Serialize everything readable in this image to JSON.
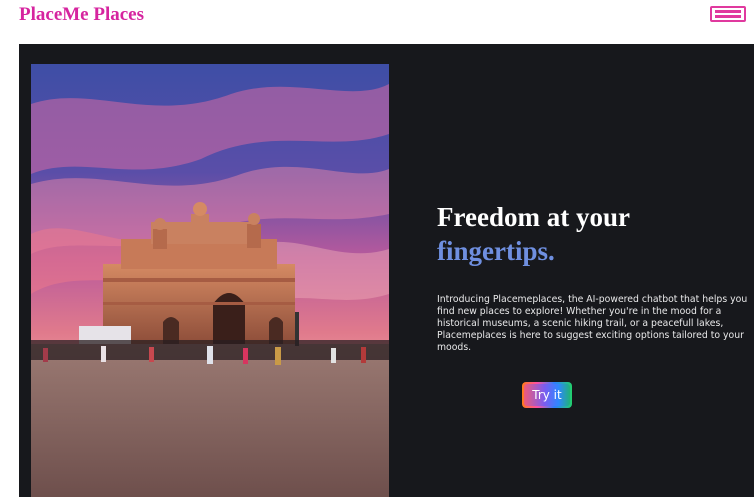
{
  "navbar": {
    "brand": "PlaceMe Places",
    "menu_icon": "hamburger-menu-icon"
  },
  "hero": {
    "image_subject": "gateway-of-india-photo",
    "headline_line1": "Freedom at your",
    "headline_line2": "fingertips.",
    "intro": "Introducing Placemeplaces, the AI-powered chatbot that helps you find new places to explore! Whether you're in the mood for a historical museums, a scenic hiking trail, or a peacefull lakes, Placemeplaces is here to suggest exciting options tailored to your moods.",
    "cta_label": "Try it"
  },
  "colors": {
    "brand": "#d6249f",
    "hero_background": "#17181c",
    "headline_white": "#ffffff",
    "headline_accent": "#6f8fe0",
    "menu_border": "#e0399e"
  }
}
